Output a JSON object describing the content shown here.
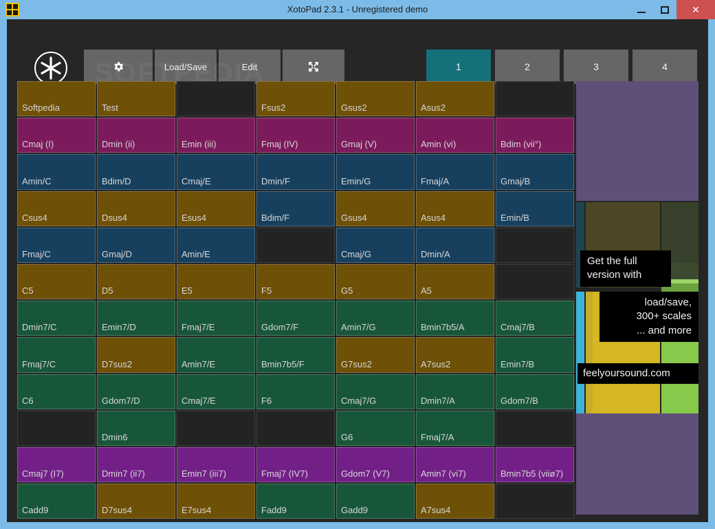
{
  "window": {
    "title": "XotoPad 2.3.1 - Unregistered demo",
    "app_icon": "grid-2x2-icon",
    "minimize_label": "minimize-icon",
    "maximize_label": "maximize-icon",
    "close_label": "✕"
  },
  "watermark": "SOFTPEDIA",
  "toolbar": {
    "logo": "asterisk-circle-logo",
    "buttons": [
      {
        "name": "settings",
        "label": "",
        "icon": "gear-icon"
      },
      {
        "name": "load-save",
        "label": "Load/Save",
        "icon": ""
      },
      {
        "name": "edit",
        "label": "Edit",
        "icon": ""
      },
      {
        "name": "fullscreen",
        "label": "",
        "icon": "expand-icon"
      }
    ],
    "presets": [
      {
        "label": "1",
        "active": true
      },
      {
        "label": "2",
        "active": false
      },
      {
        "label": "3",
        "active": false
      },
      {
        "label": "4",
        "active": false
      }
    ],
    "active_color": "#16707a",
    "button_color": "#666666"
  },
  "colors": {
    "brown": "#6e5006",
    "magenta": "#7c1b5c",
    "blue": "#17405e",
    "green": "#18563a",
    "purple": "#722088",
    "empty": "#232323",
    "background": "#262626",
    "titlebar": "#7cbbe8",
    "close_button": "#cd5150"
  },
  "pad_grid": {
    "columns": 7,
    "rows": 12,
    "cells": [
      {
        "label": "Softpedia",
        "color": "brown"
      },
      {
        "label": "Test",
        "color": "brown"
      },
      {
        "label": "",
        "color": "empty"
      },
      {
        "label": "Fsus2",
        "color": "brown"
      },
      {
        "label": "Gsus2",
        "color": "brown"
      },
      {
        "label": "Asus2",
        "color": "brown"
      },
      {
        "label": "",
        "color": "empty"
      },
      {
        "label": "Cmaj (I)",
        "color": "magenta"
      },
      {
        "label": "Dmin (ii)",
        "color": "magenta"
      },
      {
        "label": "Emin (iii)",
        "color": "magenta"
      },
      {
        "label": "Fmaj (IV)",
        "color": "magenta"
      },
      {
        "label": "Gmaj (V)",
        "color": "magenta"
      },
      {
        "label": "Amin (vi)",
        "color": "magenta"
      },
      {
        "label": "Bdim (vii°)",
        "color": "magenta"
      },
      {
        "label": "Amin/C",
        "color": "blue"
      },
      {
        "label": "Bdim/D",
        "color": "blue"
      },
      {
        "label": "Cmaj/E",
        "color": "blue"
      },
      {
        "label": "Dmin/F",
        "color": "blue"
      },
      {
        "label": "Emin/G",
        "color": "blue"
      },
      {
        "label": "Fmaj/A",
        "color": "blue"
      },
      {
        "label": "Gmaj/B",
        "color": "blue"
      },
      {
        "label": "Csus4",
        "color": "brown"
      },
      {
        "label": "Dsus4",
        "color": "brown"
      },
      {
        "label": "Esus4",
        "color": "brown"
      },
      {
        "label": "Bdim/F",
        "color": "blue"
      },
      {
        "label": "Gsus4",
        "color": "brown"
      },
      {
        "label": "Asus4",
        "color": "brown"
      },
      {
        "label": "Emin/B",
        "color": "blue"
      },
      {
        "label": "Fmaj/C",
        "color": "blue"
      },
      {
        "label": "Gmaj/D",
        "color": "blue"
      },
      {
        "label": "Amin/E",
        "color": "blue"
      },
      {
        "label": "",
        "color": "empty"
      },
      {
        "label": "Cmaj/G",
        "color": "blue"
      },
      {
        "label": "Dmin/A",
        "color": "blue"
      },
      {
        "label": "",
        "color": "empty"
      },
      {
        "label": "C5",
        "color": "brown"
      },
      {
        "label": "D5",
        "color": "brown"
      },
      {
        "label": "E5",
        "color": "brown"
      },
      {
        "label": "F5",
        "color": "brown"
      },
      {
        "label": "G5",
        "color": "brown"
      },
      {
        "label": "A5",
        "color": "brown"
      },
      {
        "label": "",
        "color": "empty"
      },
      {
        "label": "Dmin7/C",
        "color": "green"
      },
      {
        "label": "Emin7/D",
        "color": "green"
      },
      {
        "label": "Fmaj7/E",
        "color": "green"
      },
      {
        "label": "Gdom7/F",
        "color": "green"
      },
      {
        "label": "Amin7/G",
        "color": "green"
      },
      {
        "label": "Bmin7b5/A",
        "color": "green"
      },
      {
        "label": "Cmaj7/B",
        "color": "green"
      },
      {
        "label": "Fmaj7/C",
        "color": "green"
      },
      {
        "label": "D7sus2",
        "color": "brown"
      },
      {
        "label": "Amin7/E",
        "color": "green"
      },
      {
        "label": "Bmin7b5/F",
        "color": "green"
      },
      {
        "label": "G7sus2",
        "color": "brown"
      },
      {
        "label": "A7sus2",
        "color": "brown"
      },
      {
        "label": "Emin7/B",
        "color": "green"
      },
      {
        "label": "C6",
        "color": "green"
      },
      {
        "label": "Gdom7/D",
        "color": "green"
      },
      {
        "label": "Cmaj7/E",
        "color": "green"
      },
      {
        "label": "F6",
        "color": "green"
      },
      {
        "label": "Cmaj7/G",
        "color": "green"
      },
      {
        "label": "Dmin7/A",
        "color": "green"
      },
      {
        "label": "Gdom7/B",
        "color": "green"
      },
      {
        "label": "",
        "color": "empty"
      },
      {
        "label": "Dmin6",
        "color": "green"
      },
      {
        "label": "",
        "color": "empty"
      },
      {
        "label": "",
        "color": "empty"
      },
      {
        "label": "G6",
        "color": "green"
      },
      {
        "label": "Fmaj7/A",
        "color": "green"
      },
      {
        "label": "",
        "color": "empty"
      },
      {
        "label": "Cmaj7 (I7)",
        "color": "purple"
      },
      {
        "label": "Dmin7 (ii7)",
        "color": "purple"
      },
      {
        "label": "Emin7 (iii7)",
        "color": "purple"
      },
      {
        "label": "Fmaj7 (IV7)",
        "color": "purple"
      },
      {
        "label": "Gdom7 (V7)",
        "color": "purple"
      },
      {
        "label": "Amin7 (vi7)",
        "color": "purple"
      },
      {
        "label": "Bmin7b5 (viiø7)",
        "color": "purple"
      },
      {
        "label": "Cadd9",
        "color": "green"
      },
      {
        "label": "D7sus4",
        "color": "brown"
      },
      {
        "label": "E7sus4",
        "color": "brown"
      },
      {
        "label": "Fadd9",
        "color": "green"
      },
      {
        "label": "Gadd9",
        "color": "green"
      },
      {
        "label": "A7sus4",
        "color": "brown"
      },
      {
        "label": "",
        "color": "empty"
      }
    ]
  },
  "ad_panel": {
    "tooltip_1": "Get the full\nversion with",
    "tooltip_1_line1": "Get the full",
    "tooltip_1_line2": "version with",
    "tooltip_2_line1": "load/save,",
    "tooltip_2_line2": "300+ scales",
    "tooltip_2_line3": "... and more",
    "website": "feelyoursound.com"
  }
}
